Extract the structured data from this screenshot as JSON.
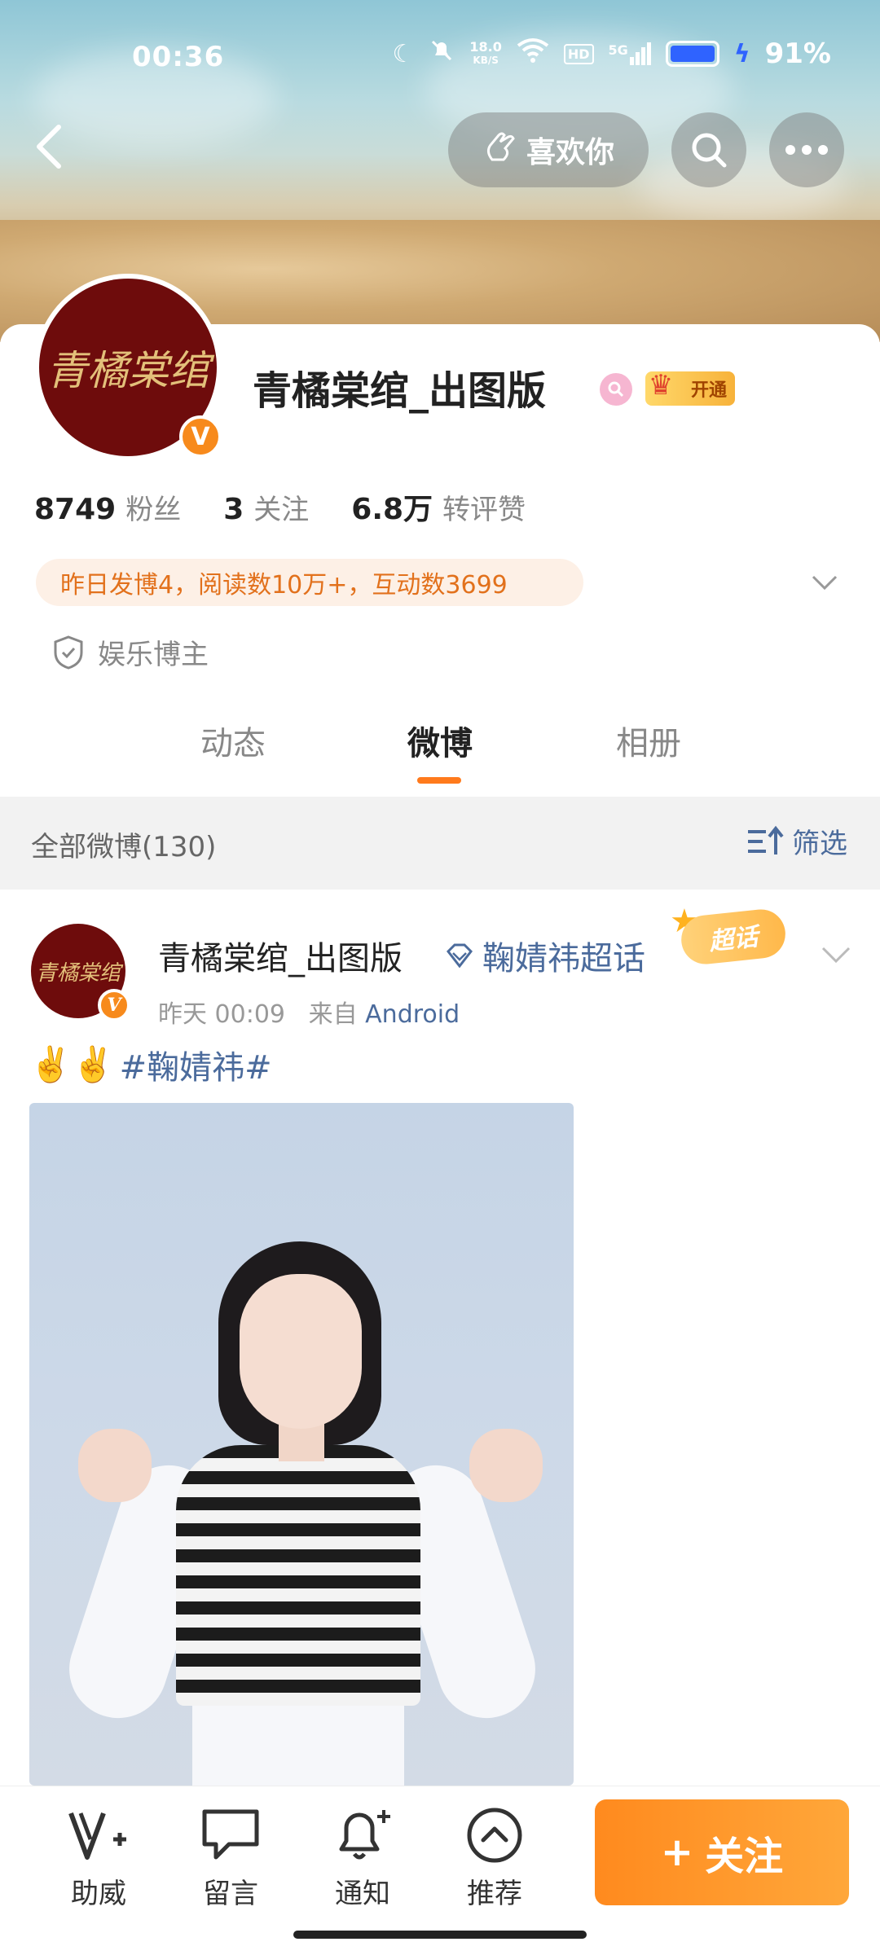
{
  "status_bar": {
    "time": "00:36",
    "net_speed_top": "18.0",
    "net_speed_unit": "KB/S",
    "hd": "HD",
    "signal": "5G",
    "battery_pct": "91%"
  },
  "header": {
    "like_label": "喜欢你"
  },
  "profile": {
    "name": "青橘棠绾_出图版",
    "vip_label": "开通",
    "avatar_text": "青橘棠绾",
    "stats": [
      {
        "num": "8749",
        "label": "粉丝"
      },
      {
        "num": "3",
        "label": "关注"
      },
      {
        "num": "6.8万",
        "label": "转评赞"
      }
    ],
    "activity": "昨日发博4，阅读数10万+，互动数3699",
    "tag": "娱乐博主"
  },
  "tabs": [
    {
      "label": "动态",
      "active": false
    },
    {
      "label": "微博",
      "active": true
    },
    {
      "label": "相册",
      "active": false
    }
  ],
  "filter_bar": {
    "count": "全部微博(130)",
    "filter_label": "筛选"
  },
  "post": {
    "author": "青橘棠绾_出图版",
    "topic": "鞠婧祎超话",
    "supertopic_badge": "超话",
    "time": "昨天 00:09",
    "source_prefix": "来自",
    "source": "Android",
    "emojis": "✌️✌️",
    "hashtag": "#鞠婧祎#"
  },
  "bottom_bar": {
    "items": [
      {
        "label": "助威"
      },
      {
        "label": "留言"
      },
      {
        "label": "通知"
      },
      {
        "label": "推荐"
      }
    ],
    "follow_label": "关注",
    "follow_plus": "+"
  },
  "colors": {
    "accent": "#ff7a1c",
    "link": "#4b6b9c",
    "activity_text": "#e2711c",
    "verified": "#f78a1c"
  }
}
